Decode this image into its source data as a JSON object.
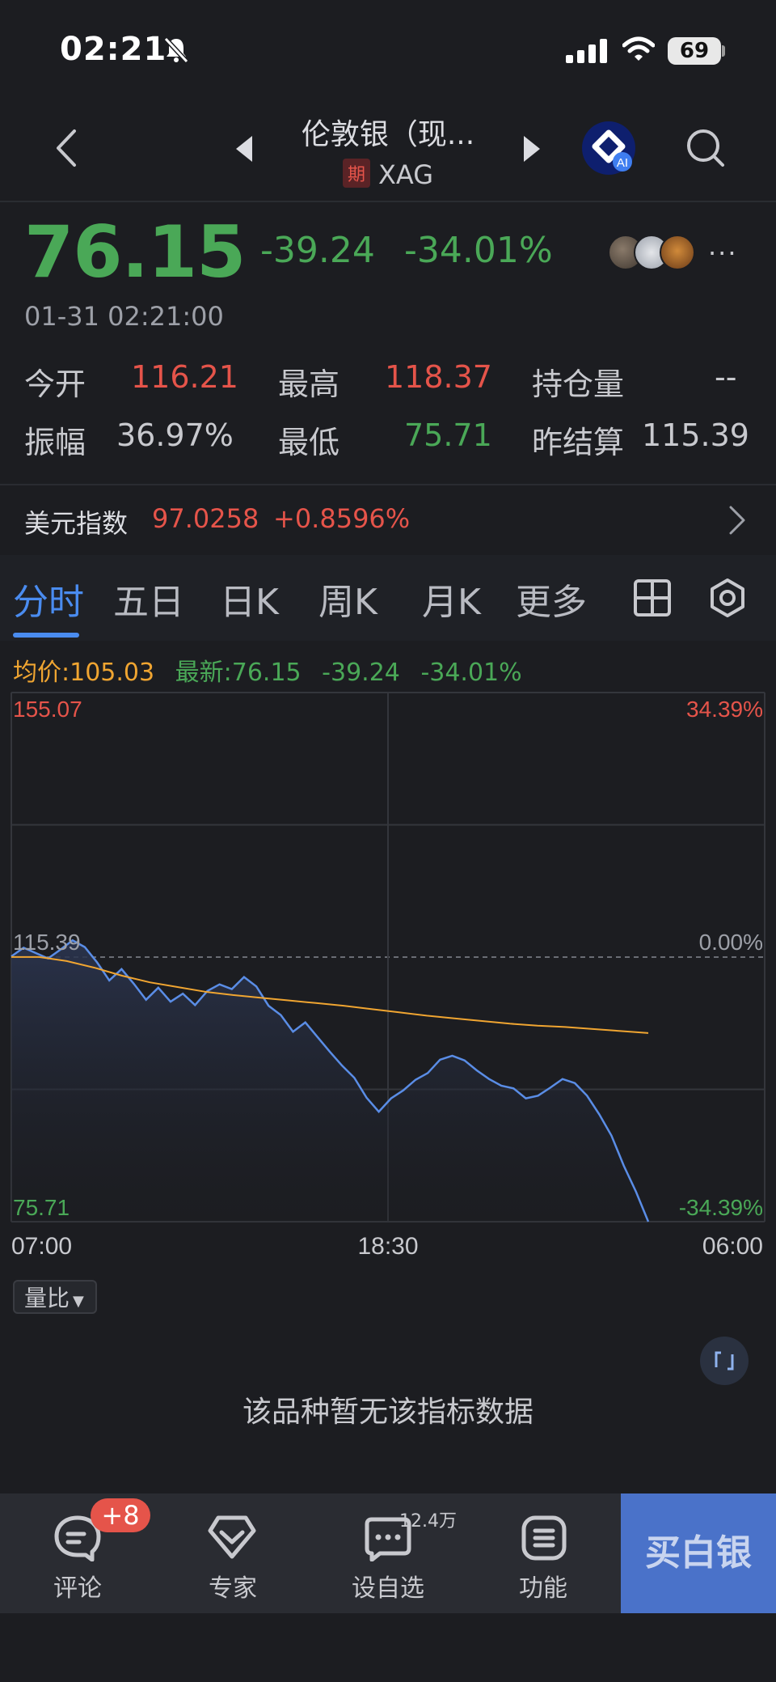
{
  "status_bar": {
    "time": "02:21",
    "battery": "69"
  },
  "header": {
    "title": "伦敦银（现...",
    "futures_tag": "期",
    "symbol": "XAG",
    "ai_badge": "AI"
  },
  "quote": {
    "price": "76.15",
    "change": "-39.24",
    "change_pct": "-34.01%",
    "timestamp": "01-31 02:21:00",
    "more": "···"
  },
  "stats": {
    "open_label": "今开",
    "open_value": "116.21",
    "high_label": "最高",
    "high_value": "118.37",
    "oi_label": "持仓量",
    "oi_value": "--",
    "amp_label": "振幅",
    "amp_value": "36.97%",
    "low_label": "最低",
    "low_value": "75.71",
    "settle_label": "昨结算",
    "settle_value": "115.39"
  },
  "dollar_index": {
    "label": "美元指数",
    "value": "97.0258",
    "change": "+0.8596%"
  },
  "tabs": [
    "分时",
    "五日",
    "日K",
    "周K",
    "月K",
    "更多"
  ],
  "chart_info": {
    "avg_label": "均价:105.03",
    "latest_label": "最新:76.15",
    "change": "-39.24",
    "change_pct": "-34.01%"
  },
  "chart_data": {
    "type": "line",
    "y_top": "155.07",
    "y_base": "115.39",
    "y_bottom": "75.71",
    "pct_top": "34.39%",
    "pct_base": "0.00%",
    "pct_bottom": "-34.39%",
    "x_labels": [
      "07:00",
      "18:30",
      "06:00"
    ],
    "ylim": [
      75.71,
      155.07
    ],
    "series": [
      {
        "values": [
          115.5,
          116.8,
          116.0,
          115.2,
          116.5,
          117.9,
          116.9,
          114.6,
          111.9,
          113.6,
          111.4,
          109.0,
          110.8,
          108.7,
          109.9,
          108.2,
          110.3,
          111.3,
          110.6,
          112.4,
          111.0,
          108.1,
          106.7,
          104.2,
          105.6,
          103.4,
          101.2,
          99.1,
          97.3,
          94.3,
          92.2,
          94.2,
          95.4,
          97.0,
          98.0,
          100.0,
          100.6,
          99.9,
          98.4,
          97.1,
          96.1,
          95.7,
          94.2,
          94.6,
          95.8,
          97.1,
          96.5,
          94.6,
          91.8,
          88.6,
          84.1,
          80.2,
          75.71
        ]
      },
      {
        "values": [
          115.4,
          115.4,
          114.8,
          113.8,
          112.6,
          111.6,
          110.9,
          110.2,
          109.7,
          109.3,
          108.9,
          108.5,
          108.1,
          107.6,
          107.1,
          106.6,
          106.2,
          105.8,
          105.4,
          105.1,
          104.9,
          104.6,
          104.3,
          104.0
        ]
      }
    ],
    "grid": true
  },
  "volume": {
    "selector": "量比",
    "no_data": "该品种暂无该指标数据"
  },
  "toolbar": {
    "comments_label": "评论",
    "comments_badge": "+8",
    "experts_label": "专家",
    "favorite_label": "设自选",
    "favorite_count": "12.4万",
    "functions_label": "功能",
    "buy_label": "买白银"
  },
  "colors": {
    "up": "#e5544a",
    "down": "#4aa857",
    "accent": "#4a8cf0",
    "avg_line": "#f0a531",
    "price_line": "#5a8de6",
    "buy_button": "#4a72c9"
  }
}
